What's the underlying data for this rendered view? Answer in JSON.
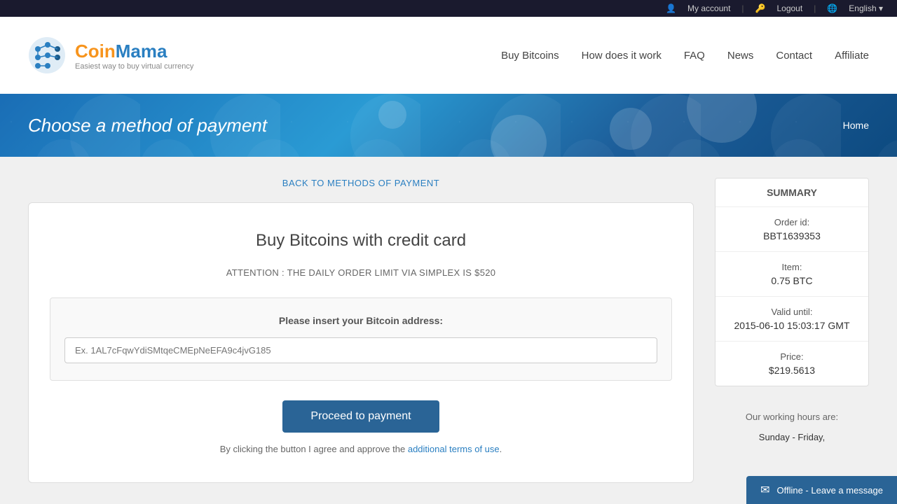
{
  "topBar": {
    "account_label": "My account",
    "logout_label": "Logout",
    "language_label": "English",
    "language_arrow": "▾"
  },
  "header": {
    "logo_brand_part1": "Coin",
    "logo_brand_part2": "Mama",
    "tagline": "Easiest way to buy virtual currency",
    "nav": {
      "buy_bitcoins": "Buy Bitcoins",
      "how_it_works": "How does it work",
      "faq": "FAQ",
      "news": "News",
      "contact": "Contact",
      "affiliate": "Affiliate"
    }
  },
  "hero": {
    "title": "Choose a method of payment",
    "breadcrumb": "Home"
  },
  "main": {
    "back_link": "BACK TO METHODS OF PAYMENT",
    "card": {
      "title": "Buy Bitcoins with credit card",
      "attention": "ATTENTION : THE DAILY ORDER LIMIT VIA SIMPLEX IS $520",
      "input_label": "Please insert your Bitcoin address:",
      "input_placeholder": "Ex. 1AL7cFqwYdiSMtqeCMEpNeEFA9c4jvG185",
      "proceed_btn": "Proceed to payment",
      "agree_prefix": "By clicking the button I agree and approve the ",
      "agree_link": "additional terms of use",
      "agree_suffix": "."
    }
  },
  "summary": {
    "title": "SUMMARY",
    "order_id_label": "Order id:",
    "order_id_value": "BBT1639353",
    "item_label": "Item:",
    "item_value": "0.75 BTC",
    "valid_until_label": "Valid until:",
    "valid_until_value": "2015-06-10 15:03:17 GMT",
    "price_label": "Price:",
    "price_value": "$219.5613",
    "working_hours_label": "Our working hours are:",
    "working_hours_days": "Sunday - Friday,"
  },
  "chat_widget": {
    "label": "Offline - Leave a message"
  }
}
